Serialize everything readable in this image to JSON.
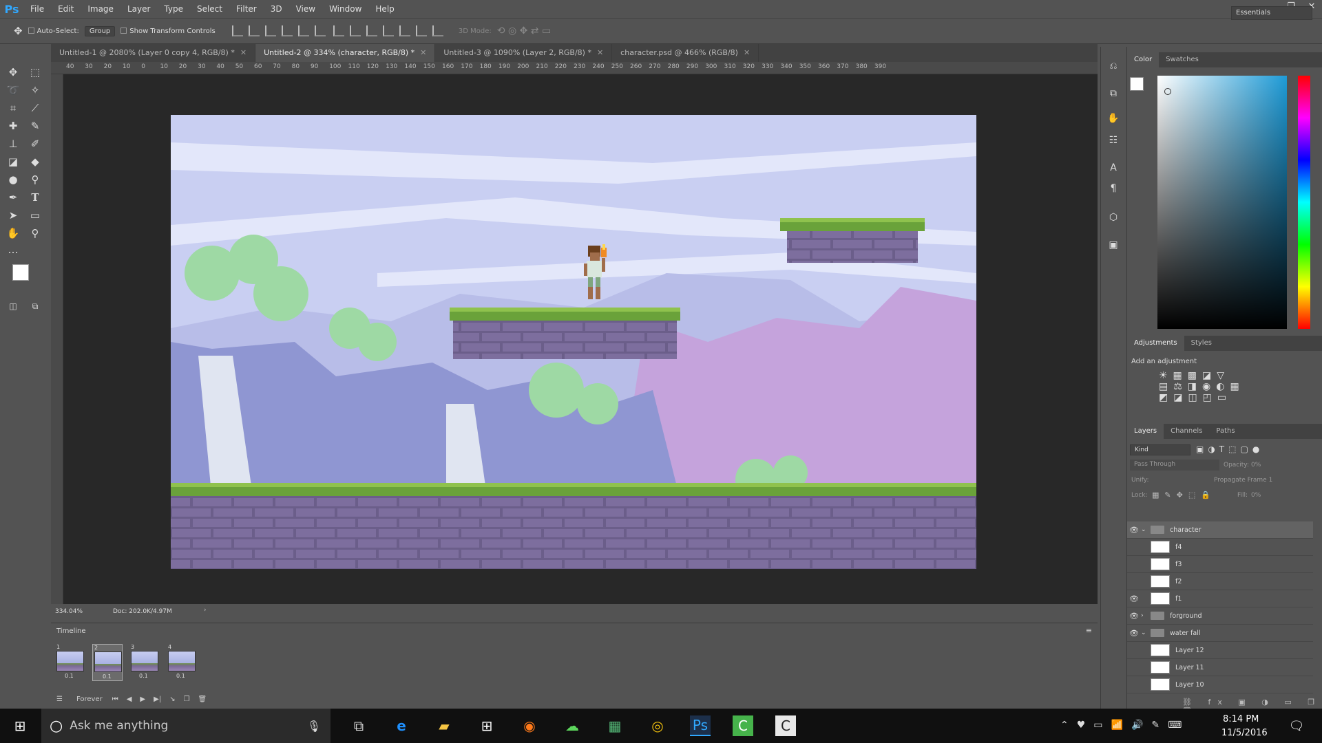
{
  "app": {
    "logo": "Ps"
  },
  "menu": [
    "File",
    "Edit",
    "Image",
    "Layer",
    "Type",
    "Select",
    "Filter",
    "3D",
    "View",
    "Window",
    "Help"
  ],
  "options": {
    "auto_select_label": "Auto-Select:",
    "group_value": "Group",
    "transform_label": "Show Transform Controls",
    "mode_3d_label": "3D Mode:",
    "workspace": "Essentials"
  },
  "tabs": [
    {
      "label": "Untitled-1 @ 2080% (Layer 0 copy 4, RGB/8) *"
    },
    {
      "label": "Untitled-2 @ 334% (character, RGB/8) *"
    },
    {
      "label": "Untitled-3 @ 1090% (Layer 2, RGB/8) *"
    },
    {
      "label": "character.psd @ 466% (RGB/8)"
    }
  ],
  "ruler_h": [
    "40",
    "30",
    "20",
    "10",
    "0",
    "10",
    "20",
    "30",
    "40",
    "50",
    "60",
    "70",
    "80",
    "90",
    "100",
    "110",
    "120",
    "130",
    "140",
    "150",
    "160",
    "170",
    "180",
    "190",
    "200",
    "210",
    "220",
    "230",
    "240",
    "250",
    "260",
    "270",
    "280",
    "290",
    "300",
    "310",
    "320",
    "330",
    "340",
    "350",
    "360",
    "370",
    "380",
    "390"
  ],
  "status": {
    "zoom": "334.04%",
    "doc": "Doc: 202.0K/4.97M"
  },
  "timeline": {
    "title": "Timeline",
    "frames": [
      {
        "n": "1",
        "d": "0.1"
      },
      {
        "n": "2",
        "d": "0.1"
      },
      {
        "n": "3",
        "d": "0.1"
      },
      {
        "n": "4",
        "d": "0.1"
      }
    ],
    "loop": "Forever"
  },
  "color_panel": {
    "tabs": [
      "Color",
      "Swatches"
    ]
  },
  "adjust_panel": {
    "tabs": [
      "Adjustments",
      "Styles"
    ],
    "add_label": "Add an adjustment"
  },
  "layers_panel": {
    "tabs": [
      "Layers",
      "Channels",
      "Paths"
    ],
    "kind": "Kind",
    "blend": "Pass Through",
    "opacity_label": "Opacity:",
    "opacity_value": "0%",
    "unify_label": "Unify:",
    "propagate": "Propagate Frame 1",
    "lock_label": "Lock:",
    "fill_label": "Fill:",
    "fill_value": "0%",
    "layers": [
      {
        "name": "character",
        "type": "group",
        "visible": true,
        "open": true
      },
      {
        "name": "f4",
        "type": "layer",
        "visible": false
      },
      {
        "name": "f3",
        "type": "layer",
        "visible": false
      },
      {
        "name": "f2",
        "type": "layer",
        "visible": false
      },
      {
        "name": "f1",
        "type": "layer",
        "visible": true
      },
      {
        "name": "forground",
        "type": "group",
        "visible": true,
        "open": false
      },
      {
        "name": "water fall",
        "type": "group",
        "visible": true,
        "open": true
      },
      {
        "name": "Layer 12",
        "type": "layer",
        "visible": false
      },
      {
        "name": "Layer 11",
        "type": "layer",
        "visible": false
      },
      {
        "name": "Layer 10",
        "type": "layer",
        "visible": false
      }
    ]
  },
  "taskbar": {
    "search_placeholder": "Ask me anything",
    "time": "8:14 PM",
    "date": "11/5/2016"
  },
  "colors": {
    "accent": "#31a8ff",
    "sky": "#c9cff2",
    "grass": "#6aa23a",
    "brick": "#7a6a96",
    "mountain": "#c5a3dc"
  }
}
